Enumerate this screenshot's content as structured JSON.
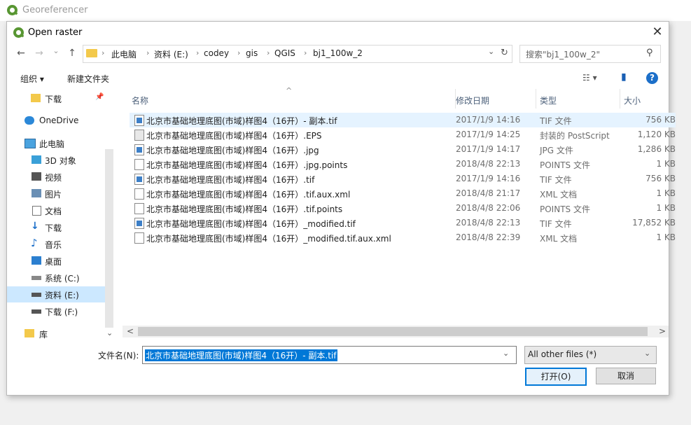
{
  "background_window": {
    "title": "Georeferencer"
  },
  "dialog": {
    "title": "Open raster",
    "close_glyph": "✕"
  },
  "nav": {
    "back_glyph": "←",
    "forward_glyph": "→",
    "recent_glyph": "⌄",
    "up_glyph": "↑",
    "refresh_glyph": "↻",
    "dropdown_glyph": "⌄",
    "breadcrumbs": [
      "此电脑",
      "资料 (E:)",
      "codey",
      "gis",
      "QGIS",
      "bj1_100w_2"
    ],
    "sep_glyph": "›"
  },
  "search": {
    "placeholder": "搜索\"bj1_100w_2\"",
    "icon_glyph": "⚲"
  },
  "toolbar": {
    "organize_label": "组织 ▾",
    "new_folder_label": "新建文件夹",
    "view_glyph": "☷ ▾",
    "pane_glyph": "▮",
    "help_glyph": "?"
  },
  "sidebar": {
    "items": [
      {
        "label": "下载",
        "pin": "📌"
      },
      {
        "label": "OneDrive"
      },
      {
        "label": "此电脑"
      },
      {
        "label": "3D 对象"
      },
      {
        "label": "视频"
      },
      {
        "label": "图片"
      },
      {
        "label": "文档"
      },
      {
        "label": "下载"
      },
      {
        "label": "音乐"
      },
      {
        "label": "桌面"
      },
      {
        "label": "系统 (C:)"
      },
      {
        "label": "资料 (E:)"
      },
      {
        "label": "下载 (F:)"
      },
      {
        "label": "库"
      }
    ],
    "expand_glyph": "⌄"
  },
  "columns": {
    "name": "名称",
    "date": "修改日期",
    "type": "类型",
    "size": "大小",
    "sort_glyph": "^"
  },
  "files": [
    {
      "name": "北京市基础地理底图(市域)样图4（16开）- 副本.tif",
      "date": "2017/1/9 14:16",
      "type": "TIF 文件",
      "size": "756 KB"
    },
    {
      "name": "北京市基础地理底图(市域)样图4（16开）.EPS",
      "date": "2017/1/9 14:25",
      "type": "封装的 PostScript",
      "size": "1,120 KB"
    },
    {
      "name": "北京市基础地理底图(市域)样图4（16开）.jpg",
      "date": "2017/1/9 14:17",
      "type": "JPG 文件",
      "size": "1,286 KB"
    },
    {
      "name": "北京市基础地理底图(市域)样图4（16开）.jpg.points",
      "date": "2018/4/8 22:13",
      "type": "POINTS 文件",
      "size": "1 KB"
    },
    {
      "name": "北京市基础地理底图(市域)样图4（16开）.tif",
      "date": "2017/1/9 14:16",
      "type": "TIF 文件",
      "size": "756 KB"
    },
    {
      "name": "北京市基础地理底图(市域)样图4（16开）.tif.aux.xml",
      "date": "2018/4/8 21:17",
      "type": "XML 文档",
      "size": "1 KB"
    },
    {
      "name": "北京市基础地理底图(市域)样图4（16开）.tif.points",
      "date": "2018/4/8 22:06",
      "type": "POINTS 文件",
      "size": "1 KB"
    },
    {
      "name": "北京市基础地理底图(市域)样图4（16开）_modified.tif",
      "date": "2018/4/8 22:13",
      "type": "TIF 文件",
      "size": "17,852 KB"
    },
    {
      "name": "北京市基础地理底图(市域)样图4（16开）_modified.tif.aux.xml",
      "date": "2018/4/8 22:39",
      "type": "XML 文档",
      "size": "1 KB"
    }
  ],
  "hscroll": {
    "left_glyph": "<",
    "right_glyph": ">"
  },
  "bottom": {
    "filename_label": "文件名(N):",
    "filename_value": "北京市基础地理底图(市域)样图4（16开）- 副本.tif",
    "dropdown_glyph": "⌄",
    "filter_value": "All other files  (*)",
    "open_label": "打开(O)",
    "cancel_label": "取消"
  }
}
